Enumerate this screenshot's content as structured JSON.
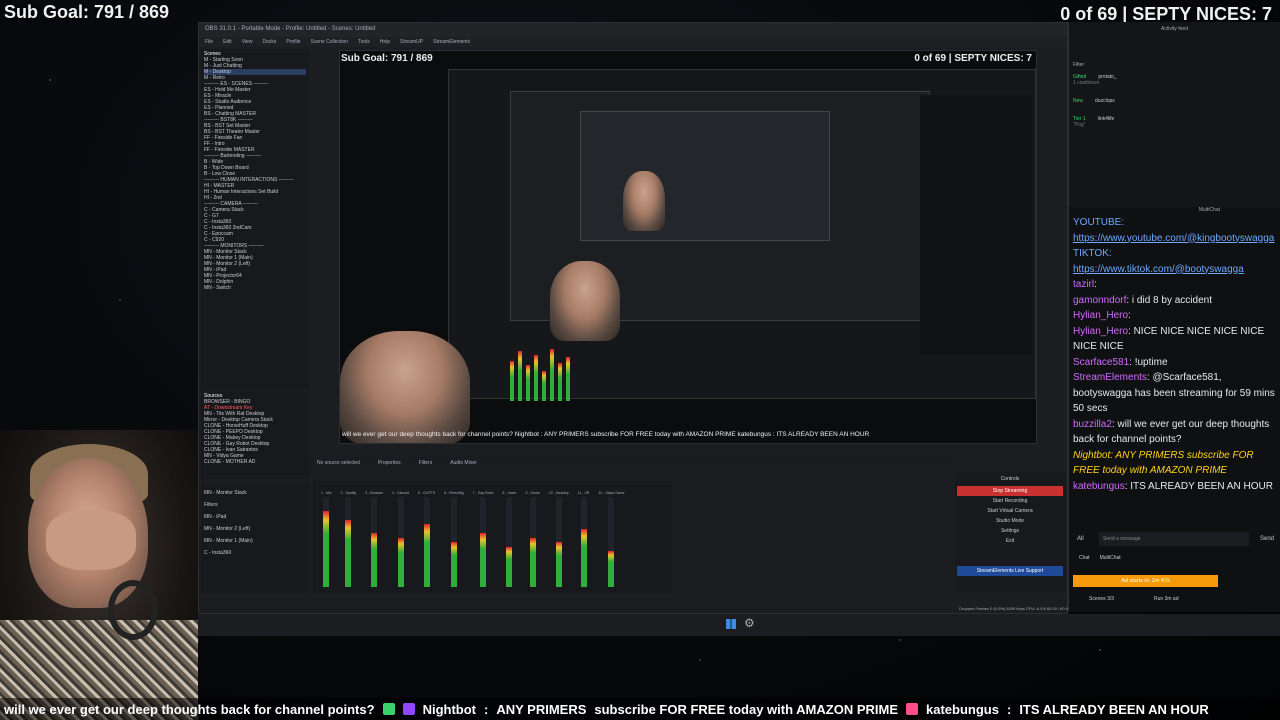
{
  "overlay": {
    "sub_goal": "Sub Goal: 791 / 869",
    "septy": "0 of 69 | SEPTY NICES: 7"
  },
  "obs": {
    "title": "OBS 31.0.1 - Portable Mode - Profile: Untitled - Scenes: Untitled",
    "menu": [
      "File",
      "Edit",
      "View",
      "Docks",
      "Profile",
      "Scene Collection",
      "Tools",
      "Help",
      "StreamUP",
      "StreamElements"
    ],
    "scenes_header": "Scenes",
    "scenes": [
      "M - Starting Soon",
      "M - Just Chatting",
      "M - Desktop",
      "M - Retro",
      "--------- ES - SCENES ---------",
      "ES - Hold Me Master",
      "ES - Miracle",
      "ES - Studio Audience",
      "ES - Planned",
      "BS - Chatting MASTER",
      "--------- BST8K ---------",
      "BS - BST Set Master",
      "BS - BST Theater Master",
      "FF - Fireside Fan",
      "FF - Intro",
      "FF - Fireside MASTER",
      "--------- Bartending ---------",
      "B - Wide",
      "B - Top Down Board",
      "B - Low Close",
      "--------- HUMAN INTERACTIONS ---------",
      "HI - MASTER",
      "HI - Human Interactions Set Build",
      "HI - 2nd",
      "--------- CAMERA ---------",
      "C - Camera Stack",
      "C - G7",
      "C - Insta360",
      "C - Insta360 2ndCam",
      "C - Epoccam",
      "C - C920",
      "--------- MONITORS ---------",
      "MN - Monitor Stack",
      "MN - Monitor 1 (Main)",
      "MN - Monitor 2 (Left)",
      "MN - iPad",
      "MN - Projector64",
      "MN - Dolphin",
      "MN - Switch"
    ],
    "sources_header": "Sources",
    "sources": [
      "BROWSER - BINGO",
      "AT - Downstream Key",
      "MN - Tits With Rat Desktop",
      "Mirror - Desktop Camera Stack",
      "CLONE - HorseHuff Desktop",
      "CLONE - PEEPO Desktop",
      "CLONE - Mabey Desktop",
      "CLONE - Gay Robot Desktop",
      "CLONE - Ivan Satrantos",
      "MN - Vidya Game",
      "CLONE - MOTHER AD"
    ],
    "bottom_scene": "MN - Monitor Stack",
    "filters": "Filters",
    "bottom_sources": [
      "MN - iPad",
      "MN - Monitor 2 (Left)",
      "MN - Monitor 1 (Main)",
      "C - Insta360"
    ],
    "no_source": "No source selected",
    "properties": "Properties",
    "filters_btn": "Filters",
    "audio_mixer": "Audio Mixer",
    "mixer_channels": [
      "1 - Mic",
      "2 - Spotify",
      "3 - Browser",
      "4 - Discord",
      "5 - Ch/TTS",
      "6 - Retro/Mg",
      "7 - Gay Robo",
      "8 - Vaxer",
      "9 - Horse",
      "10 - Desktop",
      "11 - VR",
      "12 - Vidya Game"
    ],
    "mixer_levels": [
      0.85,
      0.75,
      0.6,
      0.55,
      0.7,
      0.5,
      0.6,
      0.45,
      0.55,
      0.5,
      0.65,
      0.4
    ],
    "controls_header": "Controls",
    "controls": [
      "Stop Streaming",
      "Start Recording",
      "Start Virtual Camera",
      "Studio Mode",
      "Settings",
      "Exit"
    ],
    "stream_support": "StreamElements Live Support",
    "status": "Dropped Frames 0 (0.0%)   8209 kbps   CPU: 6.1%   60.00 / 60.00 FPS",
    "status_time": "LIVE: 25:18:03"
  },
  "preview": {
    "sub_goal": "Sub Goal: 791 / 869",
    "septy": "0 of 69 | SEPTY NICES: 7",
    "ticker": "will we ever get our deep thoughts back for channel points?   Nightbot : ANY PRIMERS subscribe FOR FREE today with AMAZON PRIME   katebungus : ITS ALREADY BEEN AN HOUR"
  },
  "activity": {
    "title": "Activity feed",
    "filter": "Filter",
    "rows": [
      {
        "badge": "Gifted",
        "user": "protato_",
        "note": "1 cowbtown"
      },
      {
        "badge": "New",
        "user": "duzclops",
        "note": ""
      },
      {
        "badge": "Tier 1",
        "user": "link4life",
        "note": "\"Pog\""
      }
    ]
  },
  "chat": {
    "header": "MultiChat",
    "youtube_label": "YOUTUBE:",
    "youtube_link": "https://www.youtube.com/@kingbootyswagga",
    "tiktok_label": "TIKTOK:",
    "tiktok_link": "https://www.tiktok.com/@bootyswagga",
    "messages": [
      {
        "user": "tazirl",
        "text": ":",
        "cls": "user-mag"
      },
      {
        "user": "gamonndorf",
        "text": ": i did 8 by accident",
        "cls": "user-mag"
      },
      {
        "user": "Hylian_Hero",
        "text": ":",
        "cls": "user-mag"
      },
      {
        "user": "Hylian_Hero",
        "text": ": NICE NICE NICE NICE NICE NICE NICE",
        "cls": "user-mag"
      },
      {
        "user": "Scarface581",
        "text": ": !uptime",
        "cls": "user-mag"
      },
      {
        "user": "StreamElements",
        "text": ": @Scarface581, bootyswagga has been streaming for 59 mins 50 secs",
        "cls": "user-mag"
      },
      {
        "user": "buzzilla2",
        "text": ": will we ever get our deep thoughts back for channel points?",
        "cls": "user-mag"
      },
      {
        "user": "Nightbot",
        "text": ": ANY PRIMERS subscribe FOR FREE today with AMAZON PRIME",
        "cls": "user-yellow"
      },
      {
        "user": "katebungus",
        "text": ": ITS ALREADY BEEN AN HOUR",
        "cls": "user-mag"
      }
    ],
    "all_filter": "All",
    "input_placeholder": "Send a message",
    "send_label": "Send",
    "tabs": [
      "Chat",
      "MultiChat"
    ],
    "ad_text": "Ad starts in: 2m 47s",
    "footer_left": "Scenes 3/3",
    "footer_right": "Run 3m ad"
  },
  "ticker": {
    "msg1": "will we ever get our deep thoughts back for channel points?",
    "user2": "Nightbot",
    "msg2a": "ANY PRIMERS",
    "msg2b": "subscribe FOR FREE today with AMAZON PRIME",
    "user3": "katebungus",
    "msg3": "ITS ALREADY BEEN AN HOUR"
  },
  "colors": {
    "accent_red": "#c93030",
    "chat_link": "#6ea8ff",
    "ad_orange": "#f59a0b"
  }
}
